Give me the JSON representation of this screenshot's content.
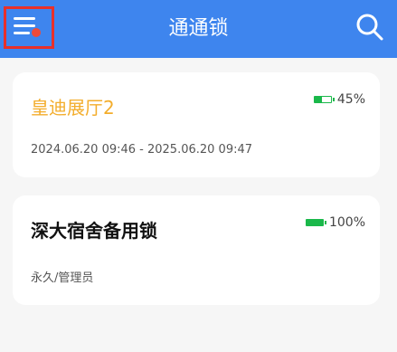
{
  "header": {
    "title": "通通锁",
    "menu_icon": "menu-icon",
    "search_icon": "search-icon",
    "accent_color": "#3e85ee",
    "notification_dot_color": "#ee4a3a"
  },
  "locks": [
    {
      "name": "皇迪展厅2",
      "name_color": "#f3ad2c",
      "battery_text": "45%",
      "battery_level": 0.45,
      "validity": "2024.06.20 09:46 - 2025.06.20 09:47"
    },
    {
      "name": "深大宿舍备用锁",
      "name_color": "#111111",
      "battery_text": "100%",
      "battery_level": 1.0,
      "validity": "永久/管理员"
    }
  ]
}
